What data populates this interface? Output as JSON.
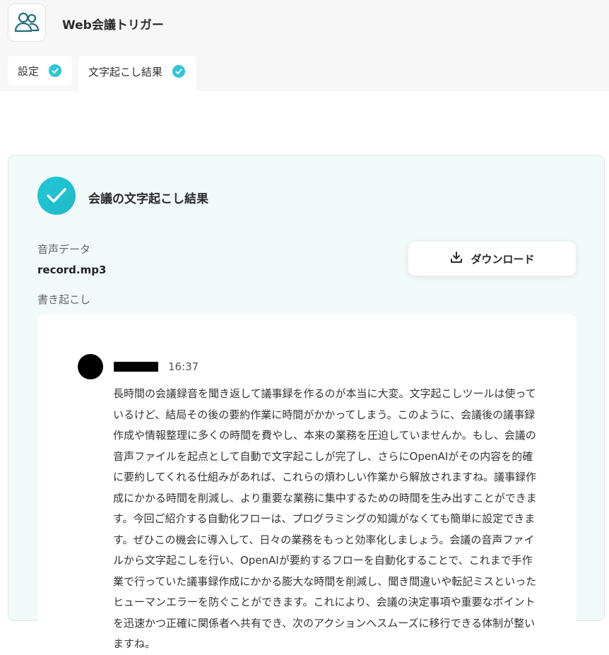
{
  "header": {
    "app_title": "Web会議トリガー",
    "app_icon": "users-icon"
  },
  "tabs": [
    {
      "label": "設定",
      "completed": true
    },
    {
      "label": "文字起こし結果",
      "completed": true,
      "active": true
    }
  ],
  "result": {
    "title": "会議の文字起こし結果",
    "audio_label": "音声データ",
    "filename": "record.mp3",
    "transcript_label": "書き起こし",
    "download_label": "ダウンロード"
  },
  "transcript": {
    "timestamp": "16:37",
    "text": "長時間の会議録音を聞き返して議事録を作るのが本当に大変。文字起こしツールは使っているけど、結局その後の要約作業に時間がかかってしまう。このように、会議後の議事録作成や情報整理に多くの時間を費やし、本来の業務を圧迫していませんか。もし、会議の音声ファイルを起点として自動で文字起こしが完了し、さらにOpenAIがその内容を的確に要約してくれる仕組みがあれば、これらの煩わしい作業から解放されますね。議事録作成にかかる時間を削減し、より重要な業務に集中するための時間を生み出すことができます。今回ご紹介する自動化フローは、プログラミングの知識がなくても簡単に設定できます。ぜひこの機会に導入して、日々の業務をもっと効率化しましょう。会議の音声ファイルから文字起こしを行い、OpenAIが要約するフローを自動化することで、これまで手作業で行っていた議事録作成にかかる膨大な時間を削減し、聞き間違いや転記ミスといったヒューマンエラーを防ぐことができます。これにより、会議の決定事項や重要なポイントを迅速かつ正確に関係者へ共有でき、次のアクションへスムーズに移行できる体制が整いますね。"
  },
  "colors": {
    "accent": "#2ec7d6",
    "card_bg": "#f1f9f9",
    "topbar_bg": "#f7f7f7"
  }
}
